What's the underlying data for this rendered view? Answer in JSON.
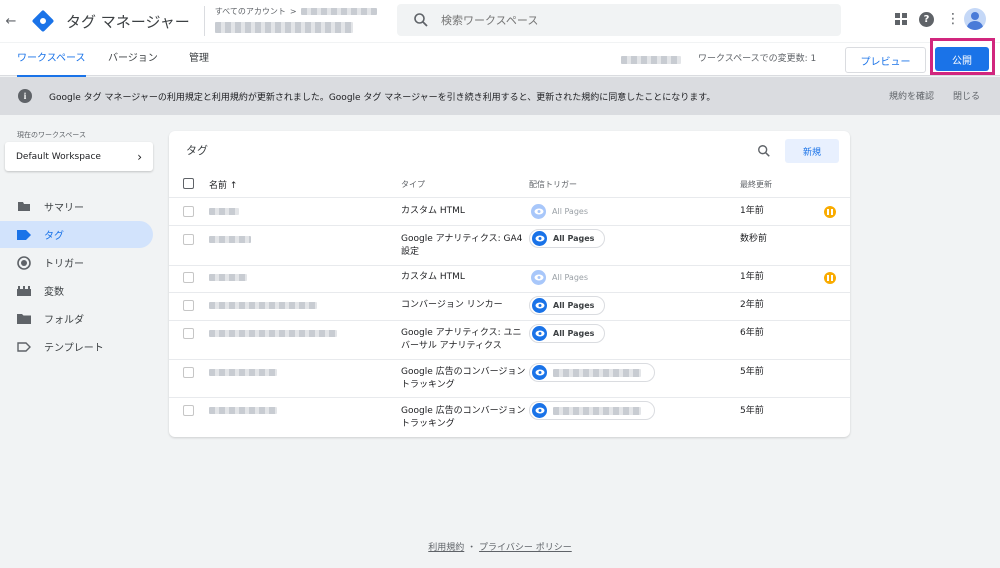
{
  "header": {
    "app_title": "タグ マネージャー",
    "breadcrumb_label": "すべてのアカウント",
    "breadcrumb_sep": ">",
    "search_placeholder": "検索ワークスペース"
  },
  "tabs": [
    {
      "label": "ワークスペース",
      "active": true
    },
    {
      "label": "バージョン",
      "active": false
    },
    {
      "label": "管理",
      "active": false
    }
  ],
  "toolbar": {
    "workspace_changes": "ワークスペースでの変更数: 1",
    "preview_label": "プレビュー",
    "publish_label": "公開"
  },
  "notice": {
    "text": "Google タグ マネージャーの利用規定と利用規約が更新されました。Google タグ マネージャーを引き続き利用すると、更新された規約に同意したことになります。",
    "review_label": "規約を確認",
    "close_label": "閉じる"
  },
  "sidebar": {
    "current_workspace_label": "現在のワークスペース",
    "workspace_name": "Default Workspace",
    "items": [
      {
        "label": "サマリー",
        "icon": "summary-icon",
        "active": false
      },
      {
        "label": "タグ",
        "icon": "tag-icon",
        "active": true
      },
      {
        "label": "トリガー",
        "icon": "trigger-icon",
        "active": false
      },
      {
        "label": "変数",
        "icon": "variables-icon",
        "active": false
      },
      {
        "label": "フォルダ",
        "icon": "folder-icon",
        "active": false
      },
      {
        "label": "テンプレート",
        "icon": "template-icon",
        "active": false
      }
    ]
  },
  "tags_card": {
    "title": "タグ",
    "new_label": "新規",
    "columns": {
      "name": "名前",
      "sort_arrow": "↑",
      "type": "タイプ",
      "trigger": "配信トリガー",
      "updated": "最終更新"
    },
    "rows": [
      {
        "type": "カスタム HTML",
        "trigger": "All Pages",
        "trigger_active": false,
        "updated": "1年前",
        "paused": true
      },
      {
        "type": "Google アナリティクス: GA4 設定",
        "trigger": "All Pages",
        "trigger_active": true,
        "updated": "数秒前",
        "paused": false
      },
      {
        "type": "カスタム HTML",
        "trigger": "All Pages",
        "trigger_active": false,
        "updated": "1年前",
        "paused": true
      },
      {
        "type": "コンバージョン リンカー",
        "trigger": "All Pages",
        "trigger_active": true,
        "updated": "2年前",
        "paused": false
      },
      {
        "type": "Google アナリティクス: ユニバーサル アナリティクス",
        "trigger": "All Pages",
        "trigger_active": true,
        "updated": "6年前",
        "paused": false
      },
      {
        "type": "Google 広告のコンバージョン トラッキング",
        "trigger": "",
        "trigger_active": true,
        "updated": "5年前",
        "paused": false
      },
      {
        "type": "Google 広告のコンバージョン トラッキング",
        "trigger": "",
        "trigger_active": true,
        "updated": "5年前",
        "paused": false
      }
    ]
  },
  "footer": {
    "terms": "利用規約",
    "separator": "・",
    "privacy": "プライバシー ポリシー"
  },
  "colors": {
    "accent": "#1a73e8",
    "highlight": "#d1267e",
    "paused": "#f9ab00"
  }
}
